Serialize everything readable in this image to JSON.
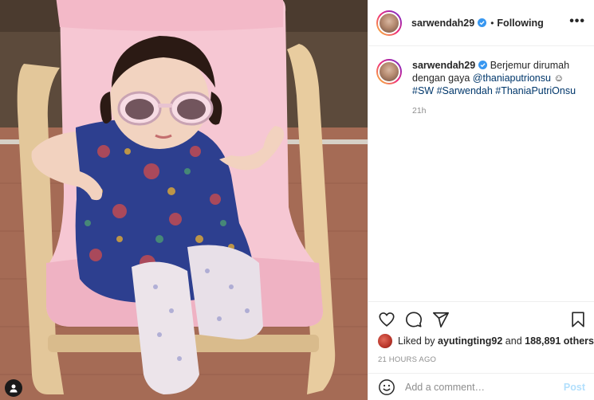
{
  "post": {
    "username": "sarwendah29",
    "separator": "•",
    "follow_status": "Following",
    "more_label": "•••",
    "caption": {
      "author": "sarwendah29",
      "text_before": "Berjemur dirumah dengan gaya",
      "mention": "@thaniaputrionsu",
      "emoji": "☺",
      "hashtags": [
        "#SW",
        "#Sarwendah",
        "#ThaniaPutriOnsu"
      ],
      "time": "21h"
    },
    "likes": {
      "prefix": "Liked by",
      "user": "ayutingting92",
      "connector": "and",
      "others": "188,891 others"
    },
    "posted_ago": "21 HOURS AGO",
    "comment_box": {
      "placeholder": "Add a comment…",
      "post_label": "Post"
    }
  },
  "colors": {
    "verified": "#3897f0",
    "link": "#00376b",
    "muted": "#8e8e8e",
    "post_button_disabled": "#b2dffc"
  },
  "icons": [
    "verified-badge-icon",
    "more-options-icon",
    "heart-icon",
    "comment-icon",
    "share-icon",
    "bookmark-icon",
    "emoji-icon",
    "user-tag-icon"
  ]
}
